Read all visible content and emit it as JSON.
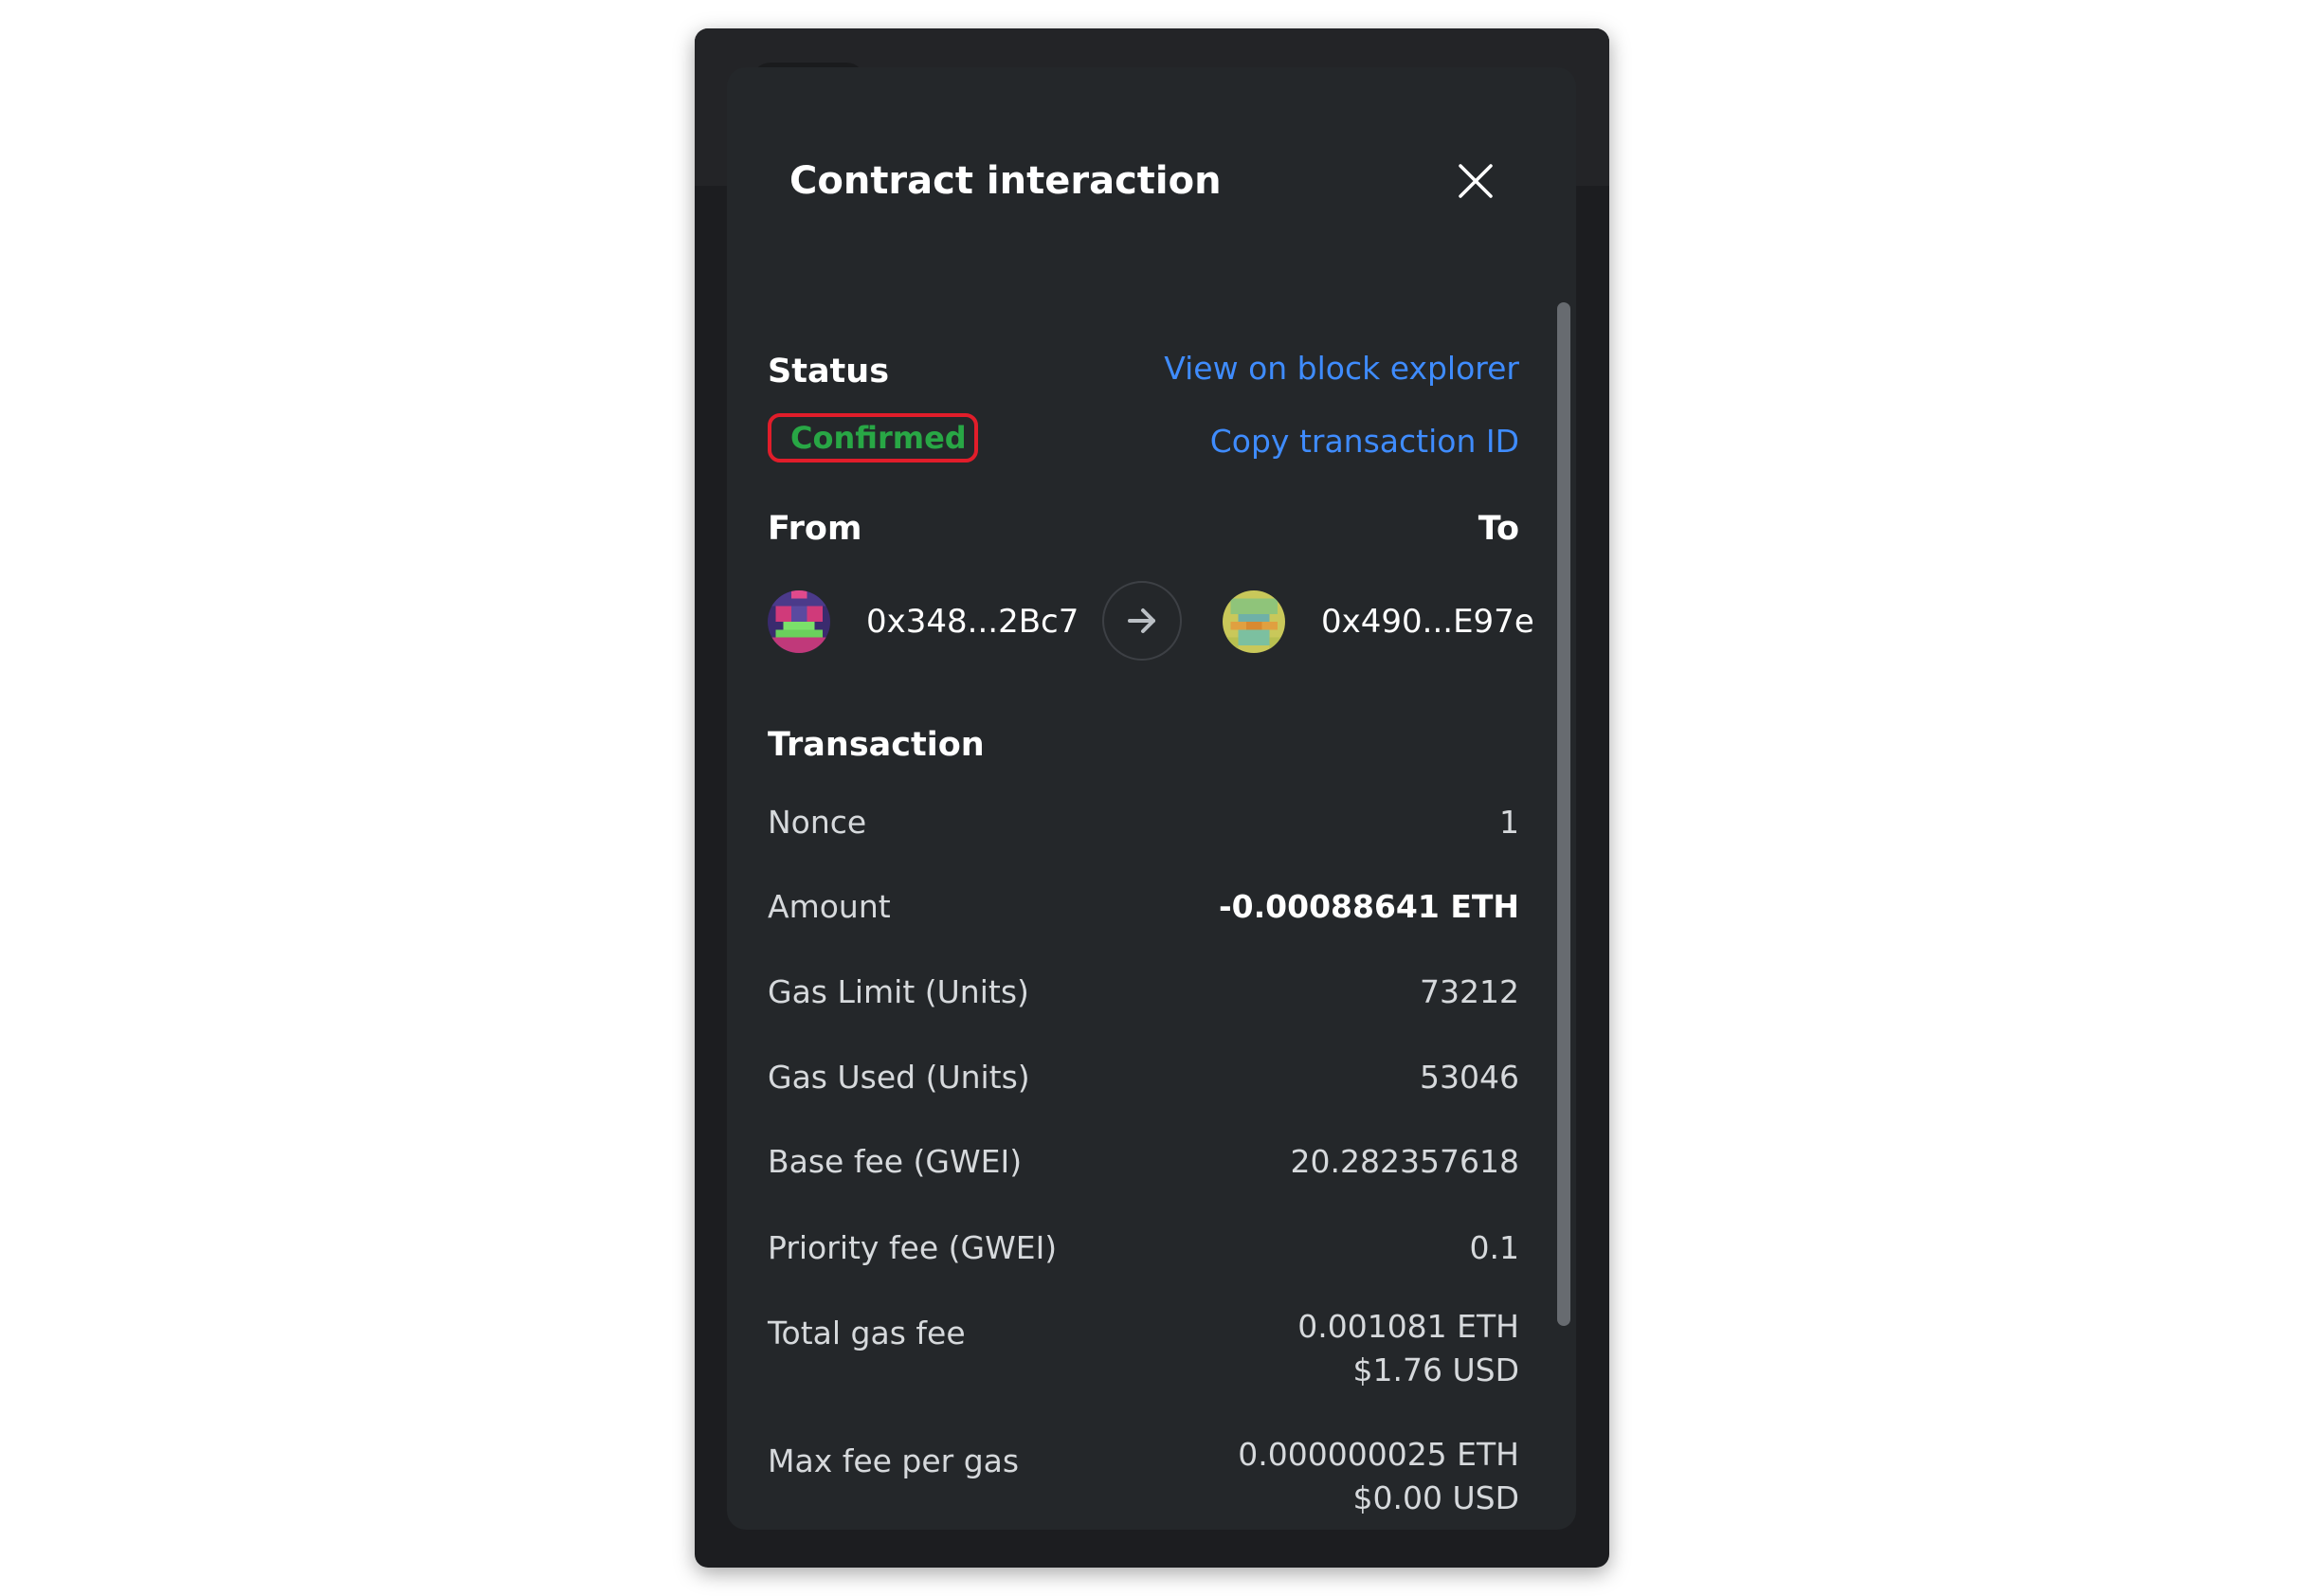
{
  "modal": {
    "title": "Contract interaction"
  },
  "status": {
    "label": "Status",
    "value": "Confirmed",
    "view_link": "View on block explorer",
    "copy_link": "Copy transaction ID"
  },
  "parties": {
    "from_label": "From",
    "to_label": "To",
    "from_address": "0x348...2Bc7",
    "to_address": "0x490...E97e"
  },
  "transaction": {
    "heading": "Transaction",
    "rows": [
      {
        "label": "Nonce",
        "value": "1"
      },
      {
        "label": "Amount",
        "value": "-0.00088641 ETH"
      },
      {
        "label": "Gas Limit (Units)",
        "value": "73212"
      },
      {
        "label": "Gas Used (Units)",
        "value": "53046"
      },
      {
        "label": "Base fee (GWEI)",
        "value": "20.282357618"
      },
      {
        "label": "Priority fee (GWEI)",
        "value": "0.1"
      },
      {
        "label": "Total gas fee",
        "value": "0.001081 ETH",
        "value2": "$1.76 USD"
      },
      {
        "label": "Max fee per gas",
        "value": "0.000000025 ETH",
        "value2": "$0.00 USD"
      }
    ]
  },
  "colors": {
    "confirmed": "#28a745",
    "link": "#3f8cff",
    "highlight": "#e11d2a"
  },
  "icons": {
    "close": "close-icon",
    "arrow": "arrow-right-icon"
  }
}
